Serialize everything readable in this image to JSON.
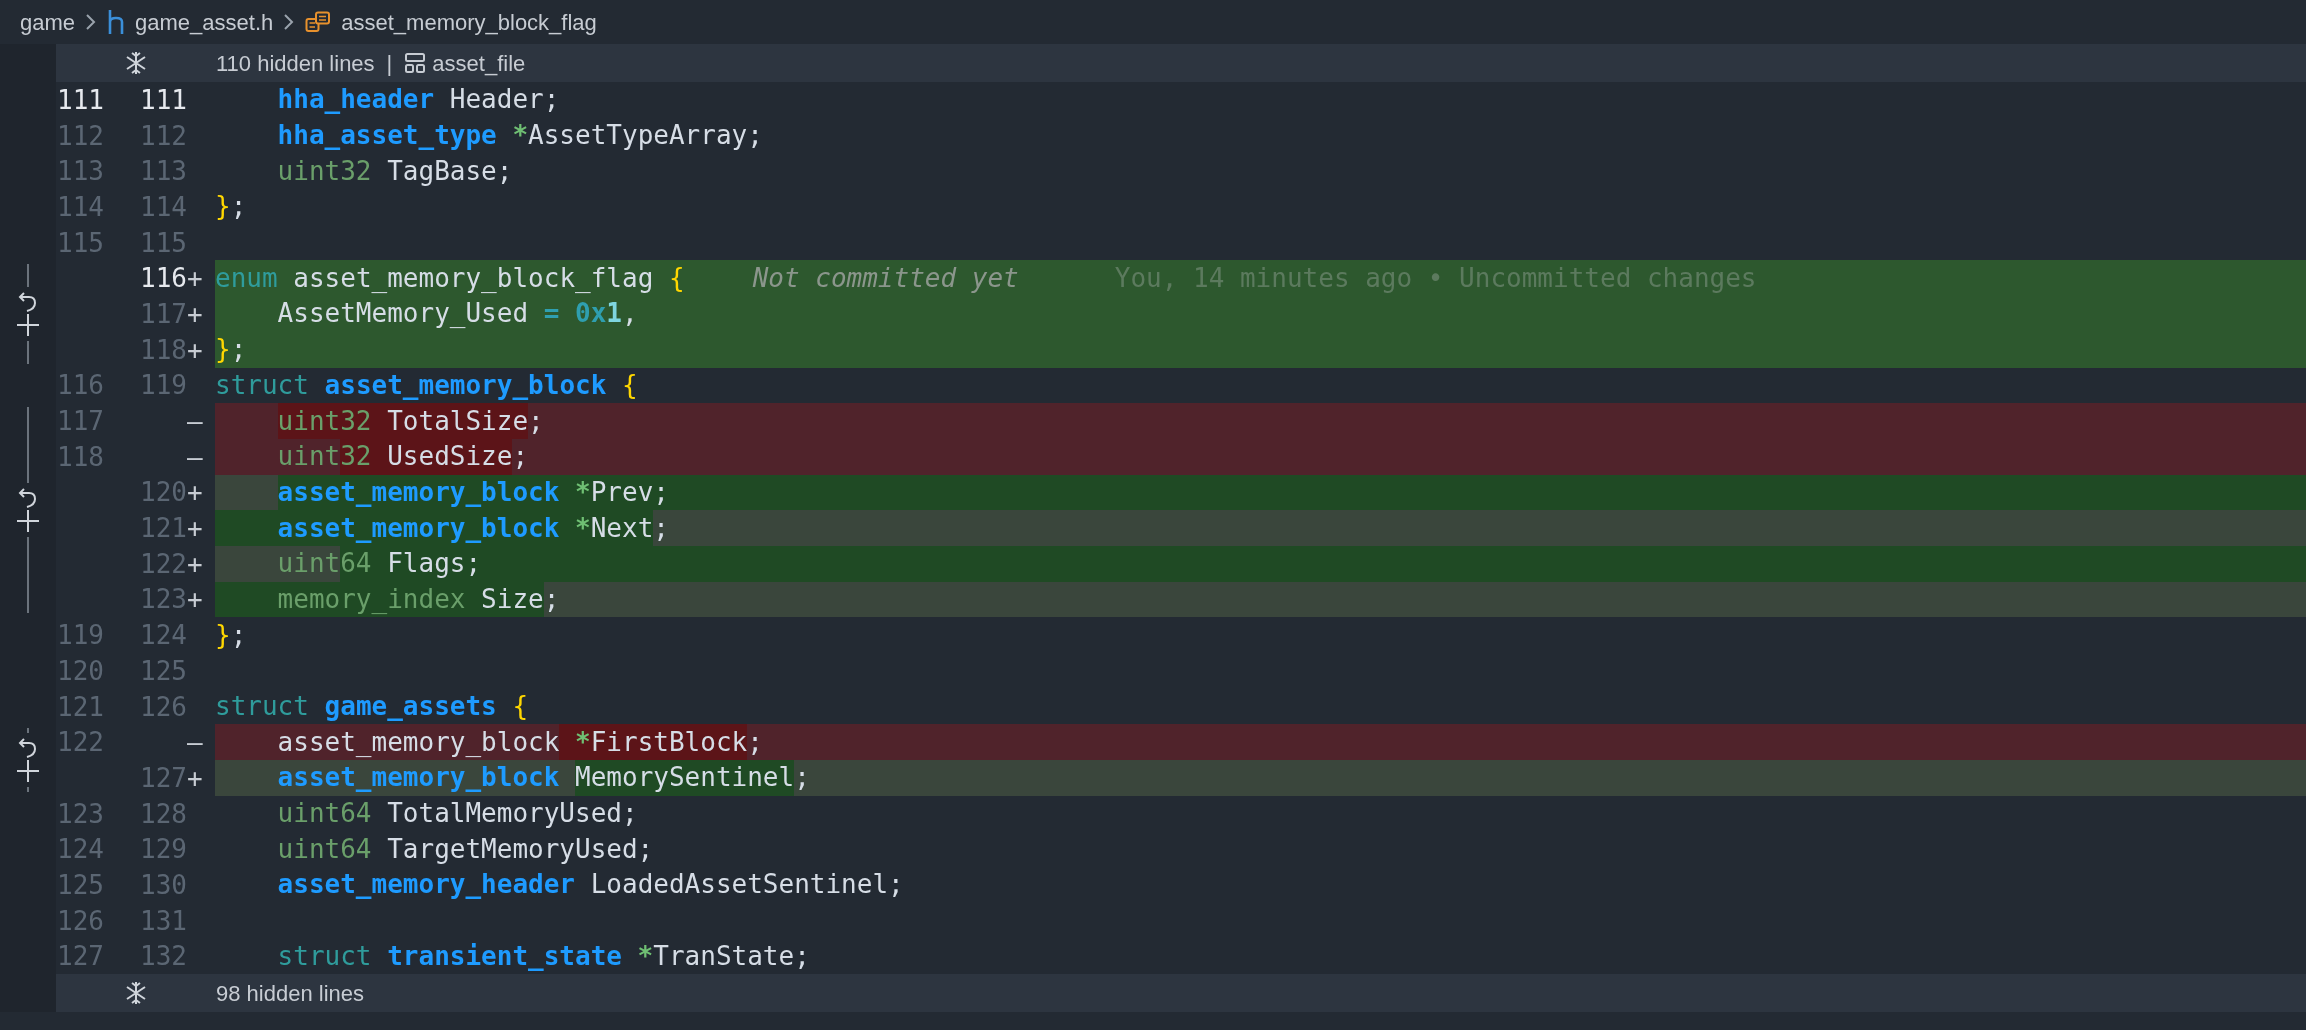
{
  "breadcrumb": [
    {
      "label": "game",
      "kind": "folder"
    },
    {
      "label": "game_asset.h",
      "kind": "header"
    },
    {
      "label": "asset_memory_block_flag",
      "kind": "enum"
    }
  ],
  "fold_top": {
    "label": "110 hidden lines",
    "separator": "|",
    "symbol": "asset_file"
  },
  "lines": [
    {
      "old": "111",
      "new": "111",
      "kind": "context",
      "current": true,
      "indent": true,
      "tokens": [
        {
          "text": "hha_header",
          "kind": "type"
        },
        {
          "text": " Header;",
          "kind": "plain"
        }
      ]
    },
    {
      "old": "112",
      "new": "112",
      "kind": "context",
      "current": false,
      "indent": true,
      "tokens": [
        {
          "text": "hha_asset_type",
          "kind": "type"
        },
        {
          "text": " *",
          "kind": "star"
        },
        {
          "text": "AssetTypeArray;",
          "kind": "plain"
        }
      ]
    },
    {
      "old": "113",
      "new": "113",
      "kind": "context",
      "current": false,
      "indent": true,
      "tokens": [
        {
          "text": "uint32",
          "kind": "prim"
        },
        {
          "text": " TagBase;",
          "kind": "plain"
        }
      ]
    },
    {
      "old": "114",
      "new": "114",
      "kind": "context",
      "current": false,
      "tokens": [
        {
          "text": "}",
          "kind": "brace"
        },
        {
          "text": ";",
          "kind": "plain"
        }
      ]
    },
    {
      "old": "115",
      "new": "115",
      "kind": "context",
      "current": false
    },
    {
      "new": "116",
      "marker": "+",
      "kind": "added_block",
      "current": true,
      "tokens": [
        {
          "text": "enum",
          "kind": "kw"
        },
        {
          "text": " asset_memory_block_flag",
          "kind": "plain"
        },
        {
          "text": " {",
          "kind": "brace"
        }
      ],
      "annotation": "Not committed yet",
      "blame": "You, 14 minutes ago • Uncommitted changes"
    },
    {
      "new": "117",
      "marker": "+",
      "kind": "added_block",
      "current": false,
      "indent": true,
      "tokens": [
        {
          "text": "AssetMemory_Used",
          "kind": "plain"
        },
        {
          "text": " =",
          "kind": "num"
        },
        {
          "text": " 0x",
          "kind": "num"
        },
        {
          "text": "1",
          "kind": "num2"
        },
        {
          "text": ",",
          "kind": "plain"
        }
      ]
    },
    {
      "new": "118",
      "marker": "+",
      "kind": "added_block",
      "current": false,
      "tokens": [
        {
          "text": "}",
          "kind": "brace"
        },
        {
          "text": ";",
          "kind": "plain"
        }
      ]
    },
    {
      "old": "116",
      "new": "119",
      "kind": "context",
      "current": false,
      "tokens": [
        {
          "text": "struct",
          "kind": "kw"
        },
        {
          "text": " asset_memory_block",
          "kind": "type"
        },
        {
          "text": " {",
          "kind": "brace"
        }
      ]
    },
    {
      "old": "117",
      "marker": "—",
      "kind": "removed",
      "current": false,
      "indent": true,
      "tokens": [
        {
          "text": "uint32",
          "kind": "prim",
          "changed": true
        },
        {
          "text": " TotalSize",
          "kind": "plain",
          "changed": true
        },
        {
          "text": ";",
          "kind": "plain"
        }
      ]
    },
    {
      "old": "118",
      "marker": "—",
      "kind": "removed",
      "current": false,
      "indent": true,
      "tokens": [
        {
          "text": "uint",
          "kind": "prim"
        },
        {
          "text": "32",
          "kind": "prim",
          "changed": true
        },
        {
          "text": " UsedSize",
          "kind": "plain",
          "changed": true
        },
        {
          "text": ";",
          "kind": "plain"
        }
      ]
    },
    {
      "new": "120",
      "marker": "+",
      "kind": "added",
      "current": false,
      "indent": true,
      "indent_changed": true,
      "tokens": [
        {
          "text": "asset_memory_block",
          "kind": "type"
        },
        {
          "text": " *",
          "kind": "star"
        },
        {
          "text": "Prev;",
          "kind": "plain"
        }
      ]
    },
    {
      "new": "121",
      "marker": "+",
      "kind": "added",
      "current": false,
      "indent": true,
      "tail": true,
      "tokens": [
        {
          "text": "asset_memory_block",
          "kind": "type"
        },
        {
          "text": " *",
          "kind": "star"
        },
        {
          "text": "Next",
          "kind": "plain"
        },
        {
          "text": ";",
          "kind": "plain",
          "changed": true
        }
      ]
    },
    {
      "new": "122",
      "marker": "+",
      "kind": "added",
      "current": false,
      "indent": true,
      "indent_changed": true,
      "tokens": [
        {
          "text": "uint",
          "kind": "prim",
          "changed": true
        },
        {
          "text": "64",
          "kind": "prim"
        },
        {
          "text": " Flags;",
          "kind": "plain"
        }
      ]
    },
    {
      "new": "123",
      "marker": "+",
      "kind": "added",
      "current": false,
      "indent": true,
      "tail": true,
      "tokens": [
        {
          "text": "memory_index",
          "kind": "prim"
        },
        {
          "text": " Size",
          "kind": "plain"
        },
        {
          "text": ";",
          "kind": "plain",
          "changed": true
        }
      ]
    },
    {
      "old": "119",
      "new": "124",
      "kind": "context",
      "current": false,
      "tokens": [
        {
          "text": "}",
          "kind": "brace"
        },
        {
          "text": ";",
          "kind": "plain"
        }
      ]
    },
    {
      "old": "120",
      "new": "125",
      "kind": "context",
      "current": false
    },
    {
      "old": "121",
      "new": "126",
      "kind": "context",
      "current": false,
      "tokens": [
        {
          "text": "struct",
          "kind": "kw"
        },
        {
          "text": " game_assets",
          "kind": "type"
        },
        {
          "text": " {",
          "kind": "brace"
        }
      ]
    },
    {
      "old": "122",
      "marker": "—",
      "kind": "removed",
      "current": false,
      "indent": true,
      "tokens": [
        {
          "text": "asset_memory_block",
          "kind": "plain"
        },
        {
          "text": " *",
          "kind": "star",
          "changed": true
        },
        {
          "text": "FirstBlock",
          "kind": "plain",
          "changed": true
        },
        {
          "text": ";",
          "kind": "plain"
        }
      ]
    },
    {
      "new": "127",
      "marker": "+",
      "kind": "added_soft",
      "current": false,
      "indent": true,
      "tokens": [
        {
          "text": "asset_memory_block ",
          "kind": "type"
        },
        {
          "text": "MemorySentinel",
          "kind": "plain",
          "changed": true
        },
        {
          "text": ";",
          "kind": "plain"
        }
      ]
    },
    {
      "old": "123",
      "new": "128",
      "kind": "context",
      "current": false,
      "indent": true,
      "tokens": [
        {
          "text": "uint64",
          "kind": "prim"
        },
        {
          "text": " TotalMemoryUsed;",
          "kind": "plain"
        }
      ]
    },
    {
      "old": "124",
      "new": "129",
      "kind": "context",
      "current": false,
      "indent": true,
      "tokens": [
        {
          "text": "uint64",
          "kind": "prim"
        },
        {
          "text": " TargetMemoryUsed;",
          "kind": "plain"
        }
      ]
    },
    {
      "old": "125",
      "new": "130",
      "kind": "context",
      "current": false,
      "indent": true,
      "tokens": [
        {
          "text": "asset_memory_header",
          "kind": "type"
        },
        {
          "text": " LoadedAssetSentinel;",
          "kind": "plain"
        }
      ]
    },
    {
      "old": "126",
      "new": "131",
      "kind": "context",
      "current": false
    },
    {
      "old": "127",
      "new": "132",
      "kind": "context",
      "current": false,
      "indent": true,
      "tokens": [
        {
          "text": "struct",
          "kind": "kw"
        },
        {
          "text": " transient_state",
          "kind": "type"
        },
        {
          "text": " *",
          "kind": "star"
        },
        {
          "text": "TranState;",
          "kind": "plain"
        }
      ]
    }
  ],
  "fold_bottom": {
    "label": "98 hidden lines"
  }
}
